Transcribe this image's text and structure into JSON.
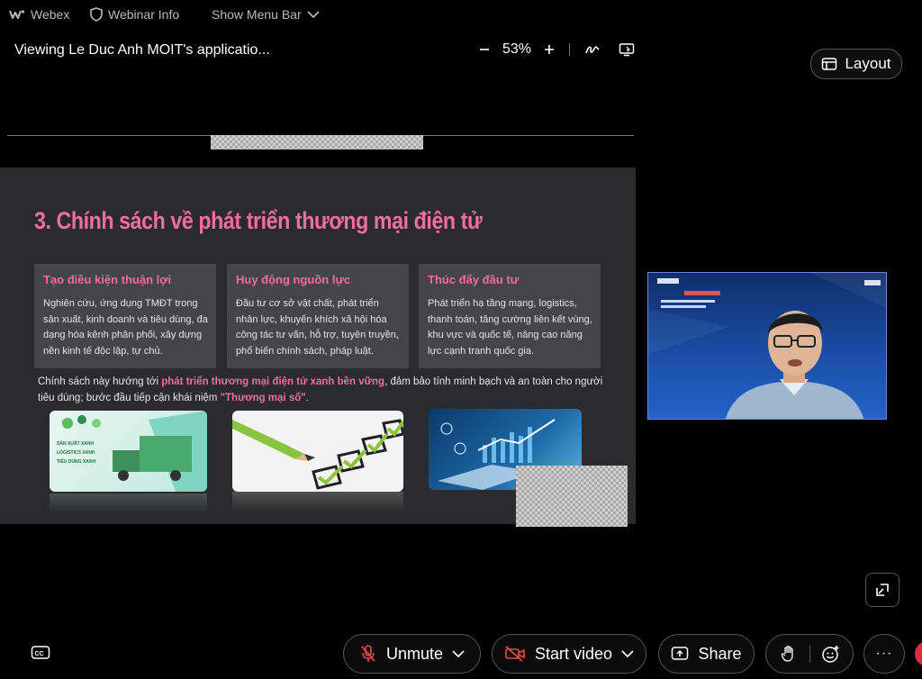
{
  "topbar": {
    "app_name": "Webex",
    "webinar_info": "Webinar Info",
    "show_menu_bar": "Show Menu Bar"
  },
  "share_title": "Viewing Le Duc Anh MOIT's applicatio...",
  "zoom": {
    "level": "53%"
  },
  "layout_label": "Layout",
  "slide": {
    "title": "3. Chính sách về phát triển thương mại điện tử",
    "cards": [
      {
        "heading": "Tạo điều kiện thuận lợi",
        "body": "Nghiên cứu, ứng dụng TMĐT trong sản xuất, kinh doanh và tiêu dùng, đa dạng hóa kênh phân phối, xây dựng nền kinh tế độc lập, tự chủ."
      },
      {
        "heading": "Huy động nguồn lực",
        "body": "Đầu tư cơ sở vật chất, phát triển nhân lực, khuyến khích xã hội hóa công tác tư vấn, hỗ trợ, tuyên truyền, phổ biến chính sách, pháp luật."
      },
      {
        "heading": "Thúc đẩy đầu tư",
        "body": "Phát triển hạ tầng mạng, logistics, thanh toán, tăng cường liên kết vùng, khu vực và quốc tế, nâng cao năng lực cạnh tranh quốc gia."
      }
    ],
    "para_prefix": "Chính sách này hướng tới ",
    "para_highlight": "phát triển thương mại điện tử xanh bền vững",
    "para_middle": ", đảm bảo tính minh bạch và an toàn cho người tiêu dùng; bước đầu tiếp cận khái niệm ",
    "para_quote": "\"Thương mại số\"",
    "para_end": ".",
    "image1_labels": [
      "SẢN XUẤT XANH",
      "LOGISTICS XANH",
      "TIÊU DÙNG XANH"
    ]
  },
  "controls": {
    "unmute": "Unmute",
    "start_video": "Start video",
    "share": "Share",
    "more": "···"
  },
  "colors": {
    "accent_pink": "#f06ea0",
    "slide_bg": "#2b2a2c",
    "card_bg": "#454446"
  }
}
